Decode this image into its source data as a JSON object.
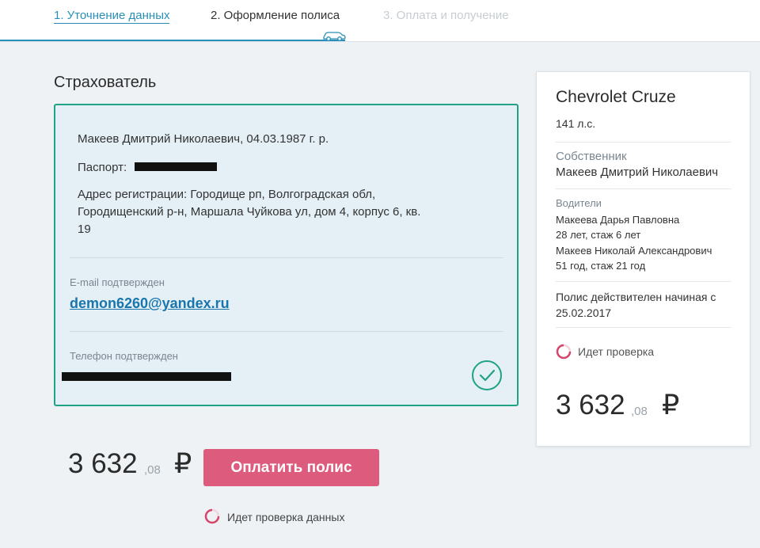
{
  "steps": [
    {
      "label": "1. Уточнение данных",
      "state": "completed"
    },
    {
      "label": "2. Оформление полиса",
      "state": "active"
    },
    {
      "label": "3. Оплата и получение",
      "state": "disabled"
    }
  ],
  "insurer": {
    "title": "Страхователь",
    "name_line": "Макеев Дмитрий Николаевич, 04.03.1987 г. р.",
    "passport_label": "Паспорт:",
    "address": "Адрес регистрации: Городище рп, Волгоградская обл, Городищенский р-н, Маршала Чуйкова ул, дом 4, корпус 6, кв. 19",
    "email_label": "E-mail подтвержден",
    "email": "demon6260@yandex.ru",
    "phone_label": "Телефон подтвержден"
  },
  "summary": {
    "car": "Chevrolet Cruze",
    "power": "141 л.с.",
    "owner_label": "Собственник",
    "owner": "Макеев Дмитрий Николаевич",
    "drivers_label": "Водители",
    "drivers": [
      {
        "name": "Макеева Дарья Павловна",
        "info": "28 лет, стаж 6 лет"
      },
      {
        "name": "Макеев Николай Александрович",
        "info": "51 год, стаж 21 год"
      }
    ],
    "validity": "Полис действителен начиная с 25.02.2017",
    "checking": "Идет проверка",
    "price_int": "3 632",
    "price_dec": ",08",
    "currency": "₽"
  },
  "bottom": {
    "price_int": "3 632",
    "price_dec": ",08",
    "currency": "₽",
    "pay_label": "Оплатить полис",
    "checking": "Идет проверка данных"
  },
  "colors": {
    "accent_blue": "#2a8fb8",
    "card_border": "#1fa384",
    "button": "#dd5b7c"
  }
}
